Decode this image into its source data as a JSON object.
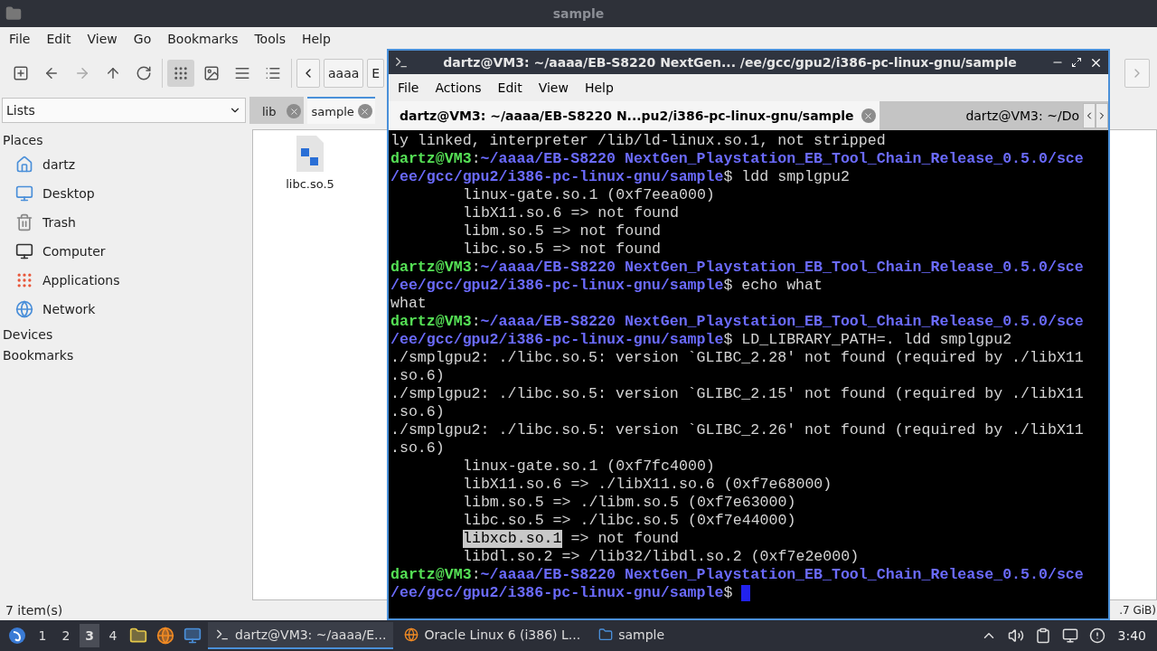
{
  "file_manager": {
    "title": "sample",
    "menu": [
      "File",
      "Edit",
      "View",
      "Go",
      "Bookmarks",
      "Tools",
      "Help"
    ],
    "toolbar": [
      {
        "kind": "new-window",
        "disabled": false,
        "selected": false
      },
      {
        "kind": "back",
        "disabled": false,
        "selected": false
      },
      {
        "kind": "forward",
        "disabled": true,
        "selected": false
      },
      {
        "kind": "up",
        "disabled": false,
        "selected": false
      },
      {
        "kind": "reload",
        "disabled": false,
        "selected": false
      },
      {
        "kind": "icon-view",
        "disabled": false,
        "selected": true
      },
      {
        "kind": "thumbnail-view",
        "disabled": false,
        "selected": false
      },
      {
        "kind": "compact-view",
        "disabled": false,
        "selected": false
      },
      {
        "kind": "detailed-view",
        "disabled": false,
        "selected": false
      }
    ],
    "path_buttons": [
      "aaaa",
      "E"
    ],
    "side_pane_mode": "Lists",
    "tabs": [
      {
        "label": "lib",
        "selected": false
      },
      {
        "label": "sample",
        "selected": true
      }
    ],
    "sidebar": [
      {
        "title": "Places",
        "items": [
          {
            "label": "dartz",
            "kind": "home"
          },
          {
            "label": "Desktop",
            "kind": "desktop"
          },
          {
            "label": "Trash",
            "kind": "trash"
          },
          {
            "label": "Computer",
            "kind": "computer"
          },
          {
            "label": "Applications",
            "kind": "applications"
          },
          {
            "label": "Network",
            "kind": "network"
          }
        ]
      },
      {
        "title": "Devices"
      },
      {
        "title": "Bookmarks"
      }
    ],
    "files": [
      {
        "name": "libc.so.5"
      }
    ],
    "status": "7 item(s)",
    "free_space": ".7 GiB)"
  },
  "terminal": {
    "title": "dartz@VM3: ~/aaaa/EB-S8220 NextGen... /ee/gcc/gpu2/i386-pc-linux-gnu/sample",
    "menu": [
      "File",
      "Actions",
      "Edit",
      "View",
      "Help"
    ],
    "tabs": [
      {
        "label": "dartz@VM3: ~/aaaa/EB-S8220 N...pu2/i386-pc-linux-gnu/sample",
        "selected": true
      },
      {
        "label": "dartz@VM3: ~/Do",
        "selected": false
      }
    ],
    "lines": [
      {
        "indent": false,
        "segments": [
          {
            "kind": "plain",
            "text": "ly linked, interpreter /lib/ld-linux.so.1, not stripped"
          }
        ]
      },
      {
        "indent": false,
        "segments": [
          {
            "kind": "user",
            "text": "dartz@VM3"
          },
          {
            "kind": "sep",
            "text": ":"
          },
          {
            "kind": "path",
            "text": "~/aaaa/EB-S8220 NextGen_Playstation_EB_Tool_Chain_Release_0.5.0/sce"
          }
        ]
      },
      {
        "indent": false,
        "segments": [
          {
            "kind": "path",
            "text": "/ee/gcc/gpu2/i386-pc-linux-gnu/sample"
          },
          {
            "kind": "plain",
            "text": "$ ldd smplgpu2"
          }
        ]
      },
      {
        "indent": true,
        "segments": [
          {
            "kind": "plain",
            "text": "linux-gate.so.1 (0xf7eea000)"
          }
        ]
      },
      {
        "indent": true,
        "segments": [
          {
            "kind": "plain",
            "text": "libX11.so.6 => not found"
          }
        ]
      },
      {
        "indent": true,
        "segments": [
          {
            "kind": "plain",
            "text": "libm.so.5 => not found"
          }
        ]
      },
      {
        "indent": true,
        "segments": [
          {
            "kind": "plain",
            "text": "libc.so.5 => not found"
          }
        ]
      },
      {
        "indent": false,
        "segments": [
          {
            "kind": "user",
            "text": "dartz@VM3"
          },
          {
            "kind": "sep",
            "text": ":"
          },
          {
            "kind": "path",
            "text": "~/aaaa/EB-S8220 NextGen_Playstation_EB_Tool_Chain_Release_0.5.0/sce"
          }
        ]
      },
      {
        "indent": false,
        "segments": [
          {
            "kind": "path",
            "text": "/ee/gcc/gpu2/i386-pc-linux-gnu/sample"
          },
          {
            "kind": "plain",
            "text": "$ echo what"
          }
        ]
      },
      {
        "indent": false,
        "segments": [
          {
            "kind": "plain",
            "text": "what"
          }
        ]
      },
      {
        "indent": false,
        "segments": [
          {
            "kind": "user",
            "text": "dartz@VM3"
          },
          {
            "kind": "sep",
            "text": ":"
          },
          {
            "kind": "path",
            "text": "~/aaaa/EB-S8220 NextGen_Playstation_EB_Tool_Chain_Release_0.5.0/sce"
          }
        ]
      },
      {
        "indent": false,
        "segments": [
          {
            "kind": "path",
            "text": "/ee/gcc/gpu2/i386-pc-linux-gnu/sample"
          },
          {
            "kind": "plain",
            "text": "$ LD_LIBRARY_PATH=. ldd smplgpu2"
          }
        ]
      },
      {
        "indent": false,
        "segments": [
          {
            "kind": "plain",
            "text": "./smplgpu2: ./libc.so.5: version `GLIBC_2.28' not found (required by ./libX11"
          }
        ]
      },
      {
        "indent": false,
        "segments": [
          {
            "kind": "plain",
            "text": ".so.6)"
          }
        ]
      },
      {
        "indent": false,
        "segments": [
          {
            "kind": "plain",
            "text": "./smplgpu2: ./libc.so.5: version `GLIBC_2.15' not found (required by ./libX11"
          }
        ]
      },
      {
        "indent": false,
        "segments": [
          {
            "kind": "plain",
            "text": ".so.6)"
          }
        ]
      },
      {
        "indent": false,
        "segments": [
          {
            "kind": "plain",
            "text": "./smplgpu2: ./libc.so.5: version `GLIBC_2.26' not found (required by ./libX11"
          }
        ]
      },
      {
        "indent": false,
        "segments": [
          {
            "kind": "plain",
            "text": ".so.6)"
          }
        ]
      },
      {
        "indent": true,
        "segments": [
          {
            "kind": "plain",
            "text": "linux-gate.so.1 (0xf7fc4000)"
          }
        ]
      },
      {
        "indent": true,
        "segments": [
          {
            "kind": "plain",
            "text": "libX11.so.6 => ./libX11.so.6 (0xf7e68000)"
          }
        ]
      },
      {
        "indent": true,
        "segments": [
          {
            "kind": "plain",
            "text": "libm.so.5 => ./libm.so.5 (0xf7e63000)"
          }
        ]
      },
      {
        "indent": true,
        "segments": [
          {
            "kind": "plain",
            "text": "libc.so.5 => ./libc.so.5 (0xf7e44000)"
          }
        ]
      },
      {
        "indent": true,
        "segments": [
          {
            "kind": "highlight",
            "text": "libxcb.so.1"
          },
          {
            "kind": "plain",
            "text": " => not found"
          }
        ]
      },
      {
        "indent": true,
        "segments": [
          {
            "kind": "plain",
            "text": "libdl.so.2 => /lib32/libdl.so.2 (0xf7e2e000)"
          }
        ]
      },
      {
        "indent": false,
        "segments": [
          {
            "kind": "user",
            "text": "dartz@VM3"
          },
          {
            "kind": "sep",
            "text": ":"
          },
          {
            "kind": "path",
            "text": "~/aaaa/EB-S8220 NextGen_Playstation_EB_Tool_Chain_Release_0.5.0/sce"
          }
        ]
      },
      {
        "indent": false,
        "segments": [
          {
            "kind": "path",
            "text": "/ee/gcc/gpu2/i386-pc-linux-gnu/sample"
          },
          {
            "kind": "plain",
            "text": "$ "
          },
          {
            "kind": "cursor"
          }
        ]
      }
    ]
  },
  "taskbar": {
    "workspaces": [
      {
        "label": "1",
        "selected": false
      },
      {
        "label": "2",
        "selected": false
      },
      {
        "label": "3",
        "selected": true
      },
      {
        "label": "4",
        "selected": false
      }
    ],
    "launchers": [
      {
        "kind": "files"
      },
      {
        "kind": "browser"
      },
      {
        "kind": "desktop"
      }
    ],
    "tasks": [
      {
        "kind": "terminal",
        "label": "dartz@VM3: ~/aaaa/E...",
        "selected": true
      },
      {
        "kind": "browser",
        "label": "Oracle Linux 6 (i386) L...",
        "selected": false
      },
      {
        "kind": "folder",
        "label": "sample",
        "selected": false
      }
    ],
    "tray": [
      {
        "kind": "up"
      },
      {
        "kind": "volume"
      },
      {
        "kind": "clipboard"
      },
      {
        "kind": "display"
      },
      {
        "kind": "alert"
      }
    ],
    "clock": "3:40"
  }
}
